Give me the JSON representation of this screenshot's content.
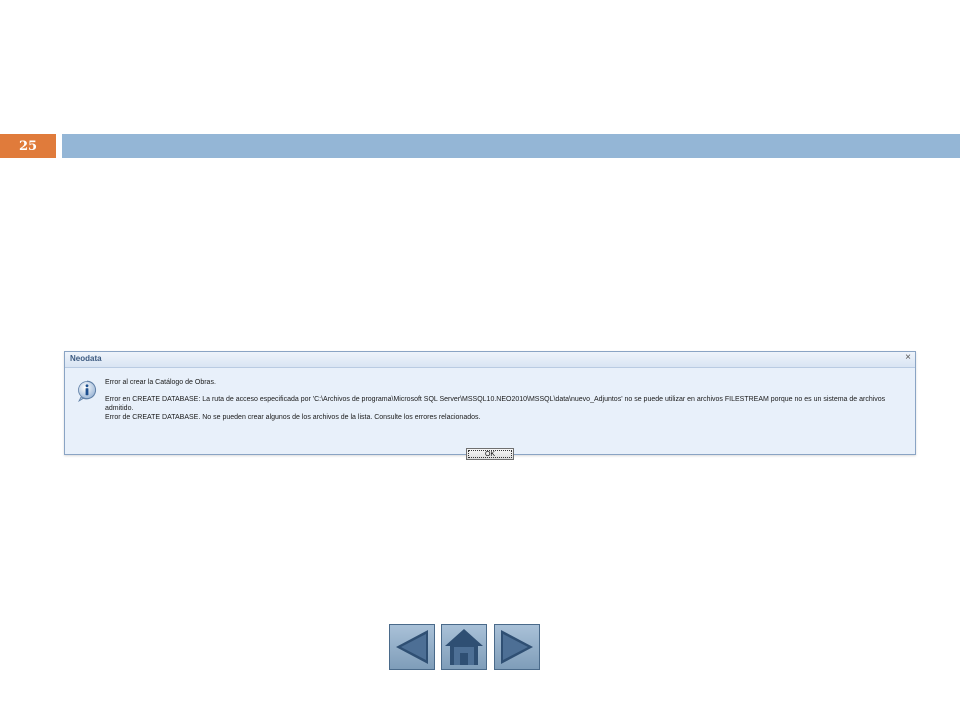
{
  "slide": {
    "number": "25"
  },
  "dialog": {
    "title": "Neodata",
    "close_symbol": "×",
    "icon": "info-icon",
    "message": {
      "line1": "Error al crear la Catálogo de Obras.",
      "line2": "Error en CREATE DATABASE: La ruta de acceso especificada por 'C:\\Archivos de programa\\Microsoft SQL Server\\MSSQL10.NEO2010\\MSSQL\\data\\nuevo_Adjuntos' no se puede utilizar en archivos FILESTREAM porque no es un sistema de archivos admitido.",
      "line3": "Error de CREATE DATABASE. No se pueden crear algunos de los archivos de la lista. Consulte los errores relacionados."
    },
    "ok_label": "OK"
  },
  "navigation": {
    "prev_icon": "left-arrow-icon",
    "home_icon": "home-icon",
    "next_icon": "right-arrow-icon"
  },
  "colors": {
    "slide_number_bg": "#e07b3b",
    "title_bar": "#94b6d6",
    "nav_button": "#7f9db9",
    "nav_glyph": "#2f4f73"
  }
}
